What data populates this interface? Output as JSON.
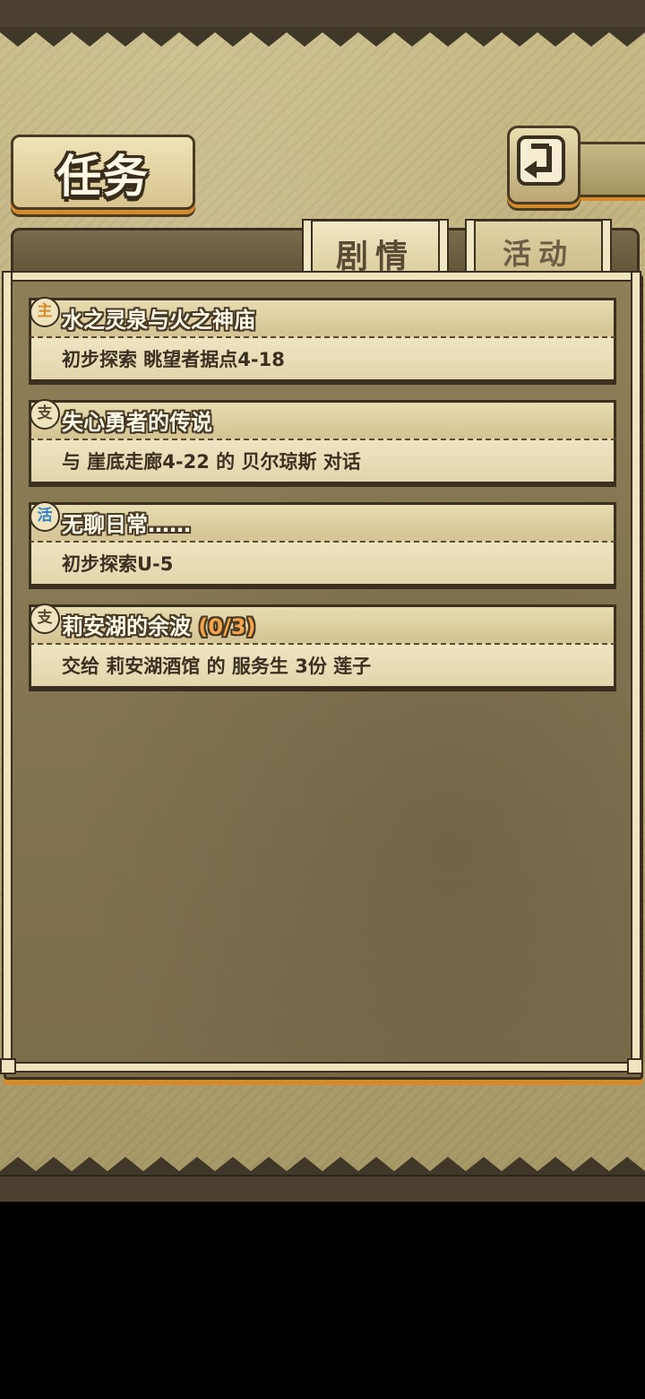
{
  "header": {
    "title": "任务"
  },
  "tabs": [
    {
      "label": "剧情",
      "active": true
    },
    {
      "label": "活动",
      "active": false
    }
  ],
  "quests": [
    {
      "badge": "主",
      "badge_type": "main",
      "title": "水之灵泉与火之神庙",
      "progress": "",
      "description": "初步探索 眺望者据点4-18"
    },
    {
      "badge": "支",
      "badge_type": "side",
      "title": "失心勇者的传说",
      "progress": "",
      "description": "与 崖底走廊4-22 的 贝尔琼斯 对话"
    },
    {
      "badge": "活",
      "badge_type": "act",
      "title": "无聊日常……",
      "progress": "",
      "description": "初步探索U-5"
    },
    {
      "badge": "支",
      "badge_type": "side",
      "title": "莉安湖的余波",
      "progress": "(0/3)",
      "description": "交给 莉安湖酒馆 的 服务生 3份 莲子"
    }
  ],
  "colors": {
    "accent_orange": "#d58a2c",
    "parchment": "#efe4bd",
    "dark_border": "#3b2f1f",
    "activity_blue": "#2c86c9"
  }
}
